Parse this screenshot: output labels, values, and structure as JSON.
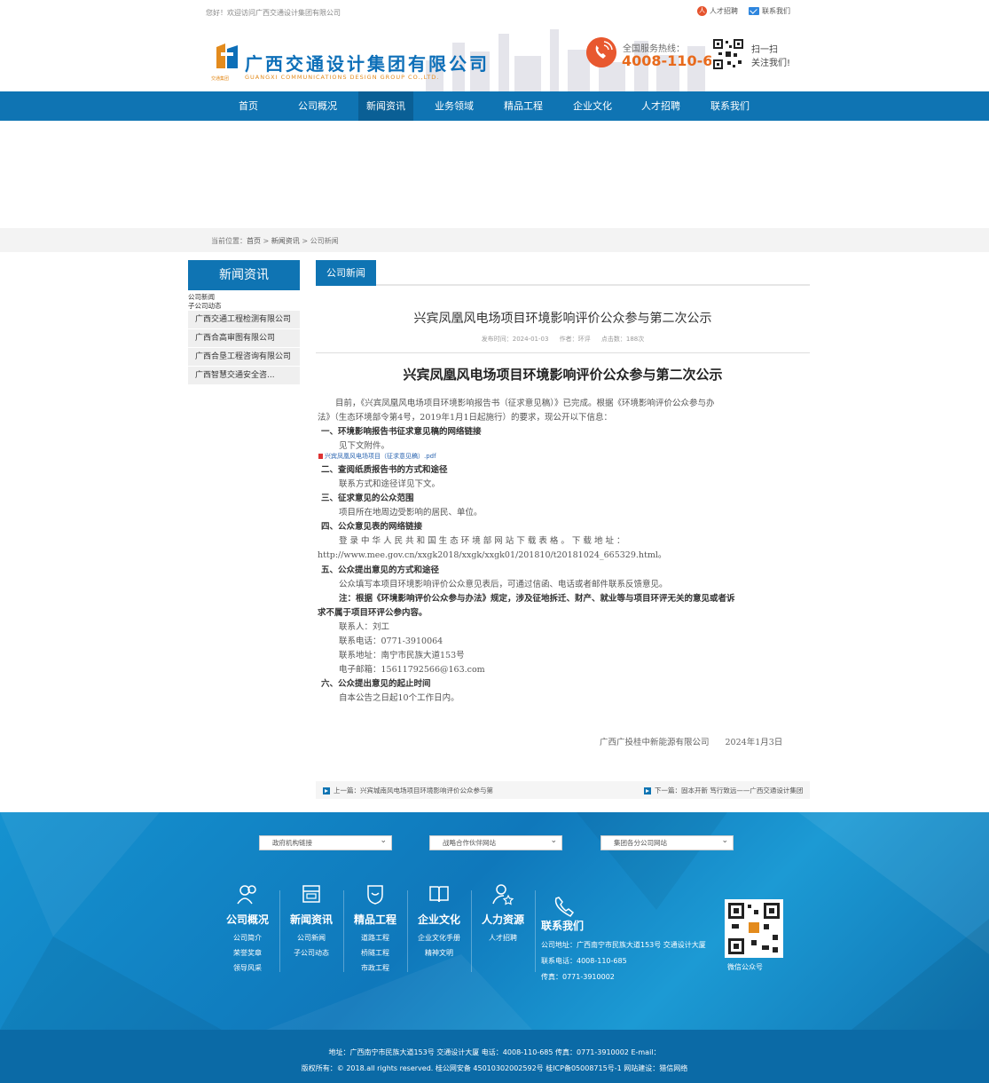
{
  "topbar": {
    "welcome": "您好！欢迎访问广西交通设计集团有限公司",
    "recruit": "人才招聘",
    "contact": "联系我们"
  },
  "header": {
    "logo_cn": "广西交通设计集团有限公司",
    "logo_en": "GUANGXI COMMUNICATIONS DESIGN GROUP CO.,LTD.",
    "logo_small": "交通集团",
    "hotline_label": "全国服务热线：",
    "hotline_number": "4008-110-685",
    "scan_line1": "扫一扫",
    "scan_line2": "关注我们!"
  },
  "nav": {
    "items": [
      "首页",
      "公司概况",
      "新闻资讯",
      "业务领域",
      "精品工程",
      "企业文化",
      "人才招聘",
      "联系我们"
    ],
    "active_index": 2
  },
  "breadcrumb": {
    "prefix": "当前位置：",
    "home": "首页",
    "sep": " > ",
    "section": "新闻资讯",
    "current": "公司新闻"
  },
  "sidebar": {
    "title": "新闻资讯",
    "small_items": [
      "公司新闻",
      "子公司动态"
    ],
    "items": [
      "广西交通工程检测有限公司",
      "广西合高审图有限公司",
      "广西合垦工程咨询有限公司",
      "广西智慧交通安全咨..."
    ]
  },
  "content": {
    "tab": "公司新闻",
    "title": "兴宾凤凰风电场项目环境影响评价公众参与第二次公示",
    "meta": {
      "date": "发布时间：2024-01-03",
      "author": "作者：环评",
      "clicks": "点击数：188次"
    },
    "body_title": "兴宾凤凰风电场项目环境影响评价公众参与第二次公示",
    "lines": [
      "目前，《兴宾凤凰风电场项目环境影响报告书（征求意见稿）》已完成。根据《环境影响评价公众参与办",
      "法》（生态环境部令第4号，2019年1月1日起施行）的要求，现公开以下信息：",
      "一、环境影响报告书征求意见稿的网络链接",
      "见下文附件。",
      "二、查阅纸质报告书的方式和途径",
      "联系方式和途径详见下文。",
      "三、征求意见的公众范围",
      "项目所在地周边受影响的居民、单位。",
      "四、公众意见表的网络链接",
      "登 录 中 华 人 民 共 和 国 生 态 环 境 部 网 站 下 载 表 格 。 下 载 地 址 ：",
      "http://www.mee.gov.cn/xxgk2018/xxgk/xxgk01/201810/t20181024_665329.html。",
      "五、公众提出意见的方式和途径",
      "公众填写本项目环境影响评价公众意见表后，可通过信函、电话或者邮件联系反馈意见。",
      "注：根据《环境影响评价公众参与办法》规定，涉及征地拆迁、财产、就业等与项目环评无关的意见或者诉",
      "求不属于项目环评公参内容。",
      "联系人：刘工",
      "联系电话：0771-3910064",
      "联系地址：南宁市民族大道153号",
      "电子邮箱：15611792566@163.com",
      "六、公众提出意见的起止时间",
      "自本公告之日起10个工作日内。"
    ],
    "attachment": "兴宾凤凰风电场项目（征求意见稿）.pdf",
    "sign_company": "广西广投桂中新能源有限公司",
    "sign_date": "2024年1月3日",
    "prev": "上一篇：兴宾城南风电场项目环境影响评价公众参与第",
    "next": "下一篇：固本开新 笃行致远——广西交通设计集团"
  },
  "footer": {
    "selects": [
      "政府机构链接",
      "战略合作伙伴网站",
      "集团各分公司网站"
    ],
    "cols": [
      {
        "icon": "people-icon",
        "title": "公司概况",
        "links": [
          "公司简介",
          "荣誉奖章",
          "领导风采"
        ]
      },
      {
        "icon": "news-icon",
        "title": "新闻资讯",
        "links": [
          "公司新闻",
          "子公司动态"
        ]
      },
      {
        "icon": "project-icon",
        "title": "精品工程",
        "links": [
          "道路工程",
          "桥隧工程",
          "市政工程"
        ]
      },
      {
        "icon": "book-icon",
        "title": "企业文化",
        "links": [
          "企业文化手册",
          "精神文明"
        ]
      },
      {
        "icon": "hr-icon",
        "title": "人力资源",
        "links": [
          "人才招聘"
        ]
      }
    ],
    "contact": {
      "title": "联系我们",
      "address": "公司地址：广西南宁市民族大道153号 交通设计大厦",
      "phone": "联系电话：4008-110-685",
      "fax": "传真：0771-3910002"
    },
    "wechat": "微信公众号",
    "copy_line1": "地址：广西南宁市民族大道153号 交通设计大厦 电话：4008-110-685 传真：0771-3910002  E-mail：",
    "copy_line2": "版权所有：© 2018.all rights reserved. 桂公网安备 45010302002592号 桂ICP备05008715号-1  网站建设：猎信网络",
    "colors": {
      "brand_blue": "#0f74b3",
      "orange": "#e86a1c"
    }
  }
}
